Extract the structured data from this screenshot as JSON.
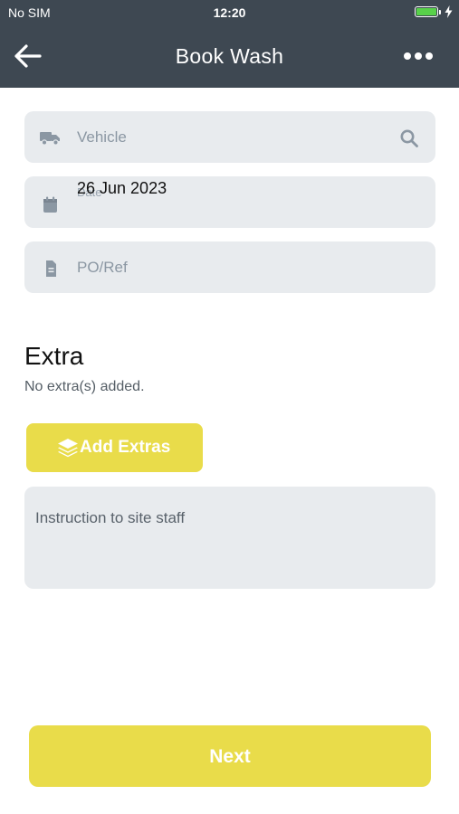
{
  "status_bar": {
    "carrier": "No SIM",
    "time": "12:20",
    "battery_level": 1.0,
    "battery_color": "#58d14a",
    "charging": true
  },
  "header": {
    "title": "Book Wash",
    "back_icon": "arrow-left-icon",
    "menu_icon": "more-dots-icon",
    "background": "#3e4852"
  },
  "form": {
    "vehicle": {
      "icon": "truck-icon",
      "placeholder": "Vehicle",
      "action_icon": "search-icon"
    },
    "date": {
      "icon": "calendar-icon",
      "value": "26 Jun 2023",
      "label": "Date"
    },
    "po_ref": {
      "icon": "document-icon",
      "placeholder": "PO/Ref"
    }
  },
  "extra": {
    "title": "Extra",
    "empty_text": "No extra(s) added.",
    "add_button": {
      "icon": "layers-icon",
      "label": "Add Extras"
    }
  },
  "instruction": {
    "placeholder": "Instruction to site staff"
  },
  "footer": {
    "next_label": "Next"
  },
  "colors": {
    "accent": "#e9dc4a",
    "field_bg": "#e8ebee",
    "placeholder": "#8b97a3"
  }
}
